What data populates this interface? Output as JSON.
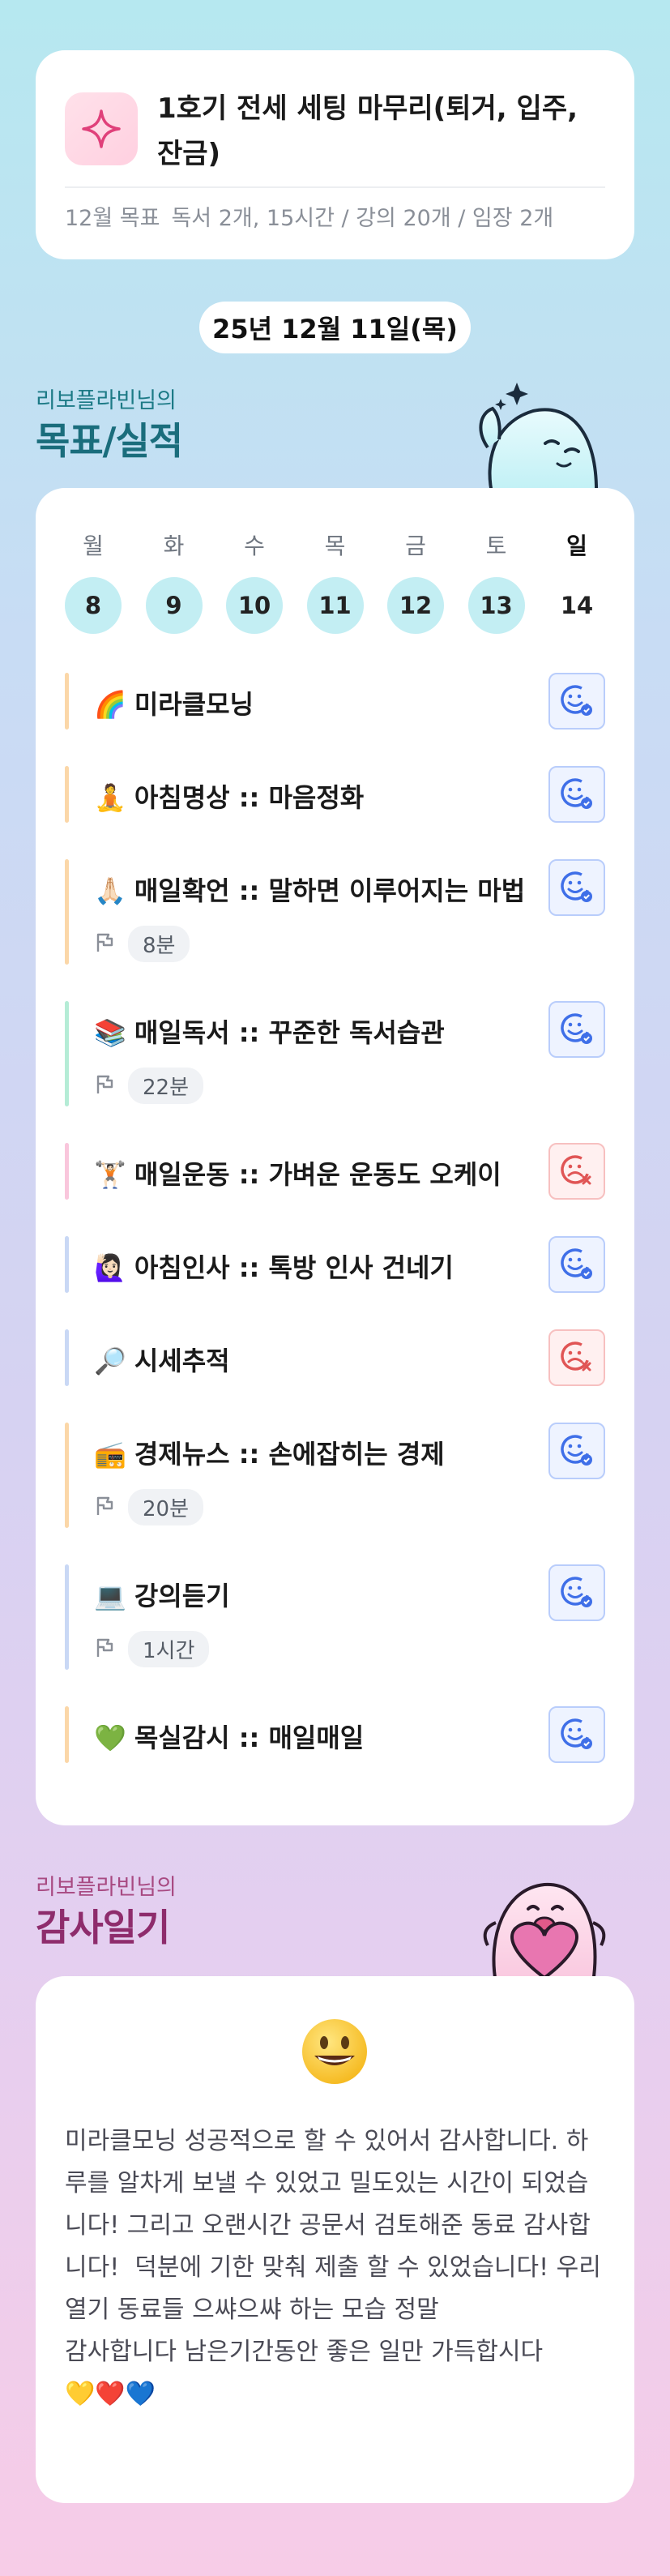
{
  "goal": {
    "title": "1호기 전세 세팅 마무리(퇴거, 입주, 잔금)",
    "period_label": "12월 목표",
    "detail": "독서 2개, 15시간 / 강의 20개 / 임장 2개"
  },
  "date_label": "25년 12월 11일(목)",
  "checklist_section": {
    "subtitle": "리보플라빈님의",
    "title": "목표/실적"
  },
  "week": {
    "days": [
      "월",
      "화",
      "수",
      "목",
      "금",
      "토",
      "일"
    ],
    "dates": [
      "8",
      "9",
      "10",
      "11",
      "12",
      "13",
      "14"
    ],
    "today_index": 6
  },
  "tasks": [
    {
      "emoji": "🌈",
      "label": "미라클모닝",
      "time": "",
      "status": "done",
      "bar_color": "#fbd7a8"
    },
    {
      "emoji": "🧘",
      "label": "아침명상 :: 마음정화",
      "time": "",
      "status": "done",
      "bar_color": "#fbd7a8"
    },
    {
      "emoji": "🙏🏻",
      "label": "매일확언 :: 말하면 이루어지는 마법",
      "time": "8분",
      "status": "done",
      "bar_color": "#fbd7a8"
    },
    {
      "emoji": "📚",
      "label": "매일독서 :: 꾸준한 독서습관",
      "time": "22분",
      "status": "done",
      "bar_color": "#b5ecd6"
    },
    {
      "emoji": "🏋🏻",
      "label": "매일운동 :: 가벼운 운동도 오케이",
      "time": "",
      "status": "fail",
      "bar_color": "#f9c6dc"
    },
    {
      "emoji": "🙋🏻‍♀️",
      "label": "아침인사 :: 톡방 인사 건네기",
      "time": "",
      "status": "done",
      "bar_color": "#c9d8f5"
    },
    {
      "emoji": "🔎",
      "label": "시세추적",
      "time": "",
      "status": "fail",
      "bar_color": "#c9d8f5"
    },
    {
      "emoji": "📻",
      "label": "경제뉴스 :: 손에잡히는 경제",
      "time": "20분",
      "status": "done",
      "bar_color": "#fbd7a8"
    },
    {
      "emoji": "💻",
      "label": "강의듣기",
      "time": "1시간",
      "status": "done",
      "bar_color": "#c9d8f5"
    },
    {
      "emoji": "💚",
      "label": "목실감시 :: 매일매일",
      "time": "",
      "status": "done",
      "bar_color": "#fbd7a8"
    }
  ],
  "diary_section": {
    "subtitle": "리보플라빈님의",
    "title": "감사일기"
  },
  "diary": {
    "mood_icon": "grinning-face-icon",
    "text": "미라클모닝 성공적으로 할 수 있어서 감사합니다. 하루를 알차게 보낼 수 있었고 밀도있는 시간이 되었습니다! 그리고 오랜시간 공문서 검토해준 동료 감사합니다!  덕분에 기한 맞춰 제출 할 수 있었습니다! 우리 열기 동료들 으쌰으쌰 하는 모습 정말\n감사합니다 남은기간동안 좋은 일만 가득합시다\n💛❤️💙"
  },
  "colors": {
    "accent_teal": "#1a6d7c",
    "accent_pink": "#8e2c6c",
    "day_circle": "#c3eef3",
    "done_icon": "#3f6fe8",
    "fail_icon": "#e05555"
  }
}
